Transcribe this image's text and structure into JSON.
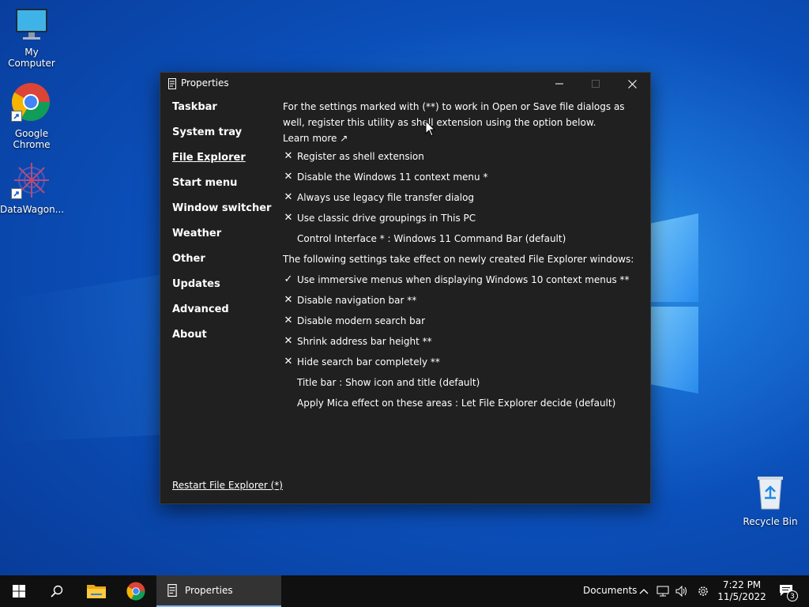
{
  "desktop": {
    "icons": [
      {
        "label": "My Computer"
      },
      {
        "label": "Google Chrome"
      },
      {
        "label": "DataWagon..."
      },
      {
        "label": "Recycle Bin"
      }
    ]
  },
  "window": {
    "title": "Properties",
    "sidebar": [
      {
        "label": "Taskbar"
      },
      {
        "label": "System tray"
      },
      {
        "label": "File Explorer"
      },
      {
        "label": "Start menu"
      },
      {
        "label": "Window switcher"
      },
      {
        "label": "Weather"
      },
      {
        "label": "Other"
      },
      {
        "label": "Updates"
      },
      {
        "label": "Advanced"
      },
      {
        "label": "About"
      }
    ],
    "intro_text": "For the settings marked with (**) to work in Open or Save file dialogs as well, register this utility as shell extension using the option below.",
    "learn_more": "Learn more ↗",
    "settings_a": [
      {
        "mark": "✕",
        "label": "Register as shell extension"
      },
      {
        "mark": "✕",
        "label": "Disable the Windows 11 context menu *"
      },
      {
        "mark": "✕",
        "label": "Always use legacy file transfer dialog"
      },
      {
        "mark": "✕",
        "label": "Use classic drive groupings in This PC"
      }
    ],
    "control_interface": "Control Interface * : Windows 11 Command Bar (default)",
    "section_note": "The following settings take effect on newly created File Explorer windows:",
    "settings_b": [
      {
        "mark": "✓",
        "label": "Use immersive menus when displaying Windows 10 context menus **"
      },
      {
        "mark": "✕",
        "label": "Disable navigation bar **"
      },
      {
        "mark": "✕",
        "label": "Disable modern search bar"
      },
      {
        "mark": "✕",
        "label": "Shrink address bar height **"
      },
      {
        "mark": "✕",
        "label": "Hide search bar completely **"
      }
    ],
    "title_bar_option": "Title bar : Show icon and title (default)",
    "mica_option": "Apply Mica effect on these areas : Let File Explorer decide (default)",
    "restart_link": "Restart File Explorer (*)"
  },
  "taskbar": {
    "active_app": "Properties",
    "toolbar_label": "Documents",
    "time": "7:22 PM",
    "date": "11/5/2022",
    "notification_count": "3"
  },
  "colors": {
    "window_bg": "#202020",
    "taskbar_bg": "#101010",
    "accent": "#7cb6f0"
  }
}
